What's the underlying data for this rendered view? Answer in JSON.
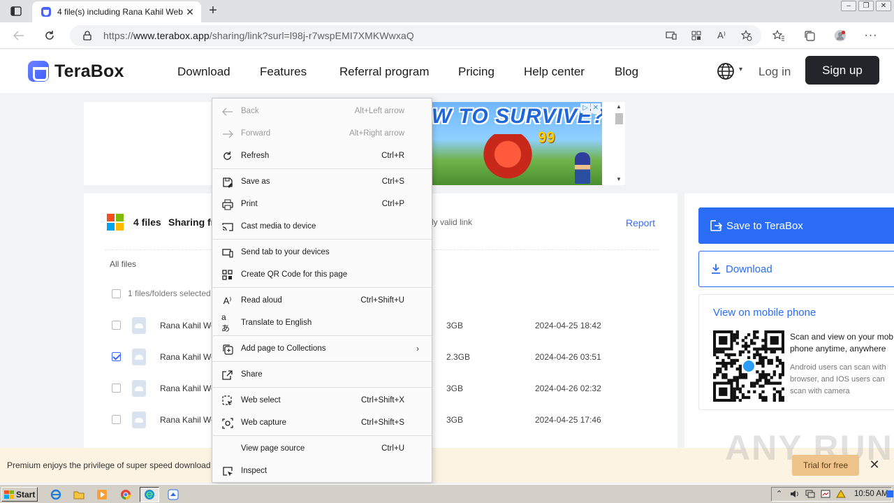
{
  "browser": {
    "tab_title": "4 file(s) including Rana Kahil Web",
    "url_prefix": "https://",
    "url_host": "www.terabox.app",
    "url_path": "/sharing/link?surl=l98j-r7wspEMI7XMKWwxaQ"
  },
  "site": {
    "logo_text": "TeraBox",
    "nav": [
      "Download",
      "Features",
      "Referral program",
      "Pricing",
      "Help center",
      "Blog"
    ],
    "login": "Log in",
    "signup": "Sign up"
  },
  "ad": {
    "headline": "W TO SURVIVE?",
    "number": "99"
  },
  "share": {
    "files_count": "4 files",
    "sharing_from": "Sharing fr",
    "valid_link": "ly valid link",
    "report": "Report",
    "all_files": "All files",
    "selected": "1 files/folders selected",
    "files": [
      {
        "name": "Rana Kahil We",
        "size": "3GB",
        "date": "2024-04-25 18:42",
        "checked": false
      },
      {
        "name": "Rana Kahil We",
        "size": "2.3GB",
        "date": "2024-04-26 03:51",
        "checked": true
      },
      {
        "name": "Rana Kahil We",
        "size": "3GB",
        "date": "2024-04-26 02:32",
        "checked": false
      },
      {
        "name": "Rana Kahil We",
        "size": "3GB",
        "date": "2024-04-25 17:46",
        "checked": false
      }
    ]
  },
  "side": {
    "save": "Save to TeraBox",
    "download": "Download",
    "mobile_title": "View on mobile phone",
    "scan_title": "Scan and view on your mob phone anytime, anywhere",
    "scan_desc": "Android users can scan with browser, and IOS users can scan with camera"
  },
  "premium": {
    "text": "Premium enjoys the privilege of super speed download",
    "trial": "Trial for free",
    "watermark": "ANY RUN"
  },
  "context_menu": {
    "items": [
      {
        "label": "Back",
        "shortcut": "Alt+Left arrow",
        "icon": "back-arrow-icon",
        "disabled": true
      },
      {
        "label": "Forward",
        "shortcut": "Alt+Right arrow",
        "icon": "forward-arrow-icon",
        "disabled": true
      },
      {
        "label": "Refresh",
        "shortcut": "Ctrl+R",
        "icon": "refresh-icon"
      },
      {
        "label": "Save as",
        "shortcut": "Ctrl+S",
        "icon": "save-as-icon"
      },
      {
        "label": "Print",
        "shortcut": "Ctrl+P",
        "icon": "print-icon"
      },
      {
        "label": "Cast media to device",
        "shortcut": "",
        "icon": "cast-icon"
      },
      {
        "label": "Send tab to your devices",
        "shortcut": "",
        "icon": "send-tab-icon"
      },
      {
        "label": "Create QR Code for this page",
        "shortcut": "",
        "icon": "qr-code-icon"
      },
      {
        "label": "Read aloud",
        "shortcut": "Ctrl+Shift+U",
        "icon": "read-aloud-icon"
      },
      {
        "label": "Translate to English",
        "shortcut": "",
        "icon": "translate-icon"
      },
      {
        "label": "Add page to Collections",
        "shortcut": "",
        "icon": "collections-icon"
      },
      {
        "label": "Share",
        "shortcut": "",
        "icon": "share-icon"
      },
      {
        "label": "Web select",
        "shortcut": "Ctrl+Shift+X",
        "icon": "web-select-icon"
      },
      {
        "label": "Web capture",
        "shortcut": "Ctrl+Shift+S",
        "icon": "web-capture-icon"
      },
      {
        "label": "View page source",
        "shortcut": "Ctrl+U",
        "icon": ""
      },
      {
        "label": "Inspect",
        "shortcut": "",
        "icon": "inspect-icon"
      }
    ]
  },
  "taskbar": {
    "start": "Start",
    "clock": "10:50 AM"
  },
  "colors": {
    "accent_blue": "#2a6df4",
    "signup_dark": "#23252a",
    "premium_bg": "#fdf3e3",
    "trial_gold": "#eec48b"
  }
}
